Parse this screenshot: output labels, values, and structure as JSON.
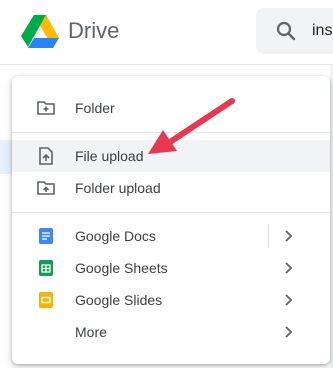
{
  "header": {
    "title": "Drive",
    "search_value": "ins"
  },
  "menu": {
    "folder": "Folder",
    "file_upload": "File upload",
    "folder_upload": "Folder upload",
    "google_docs": "Google Docs",
    "google_sheets": "Google Sheets",
    "google_slides": "Google Slides",
    "more": "More"
  },
  "colors": {
    "arrow": "#e8384f",
    "docs": "#4285f4",
    "sheets": "#0f9d58",
    "slides": "#f4b400"
  }
}
